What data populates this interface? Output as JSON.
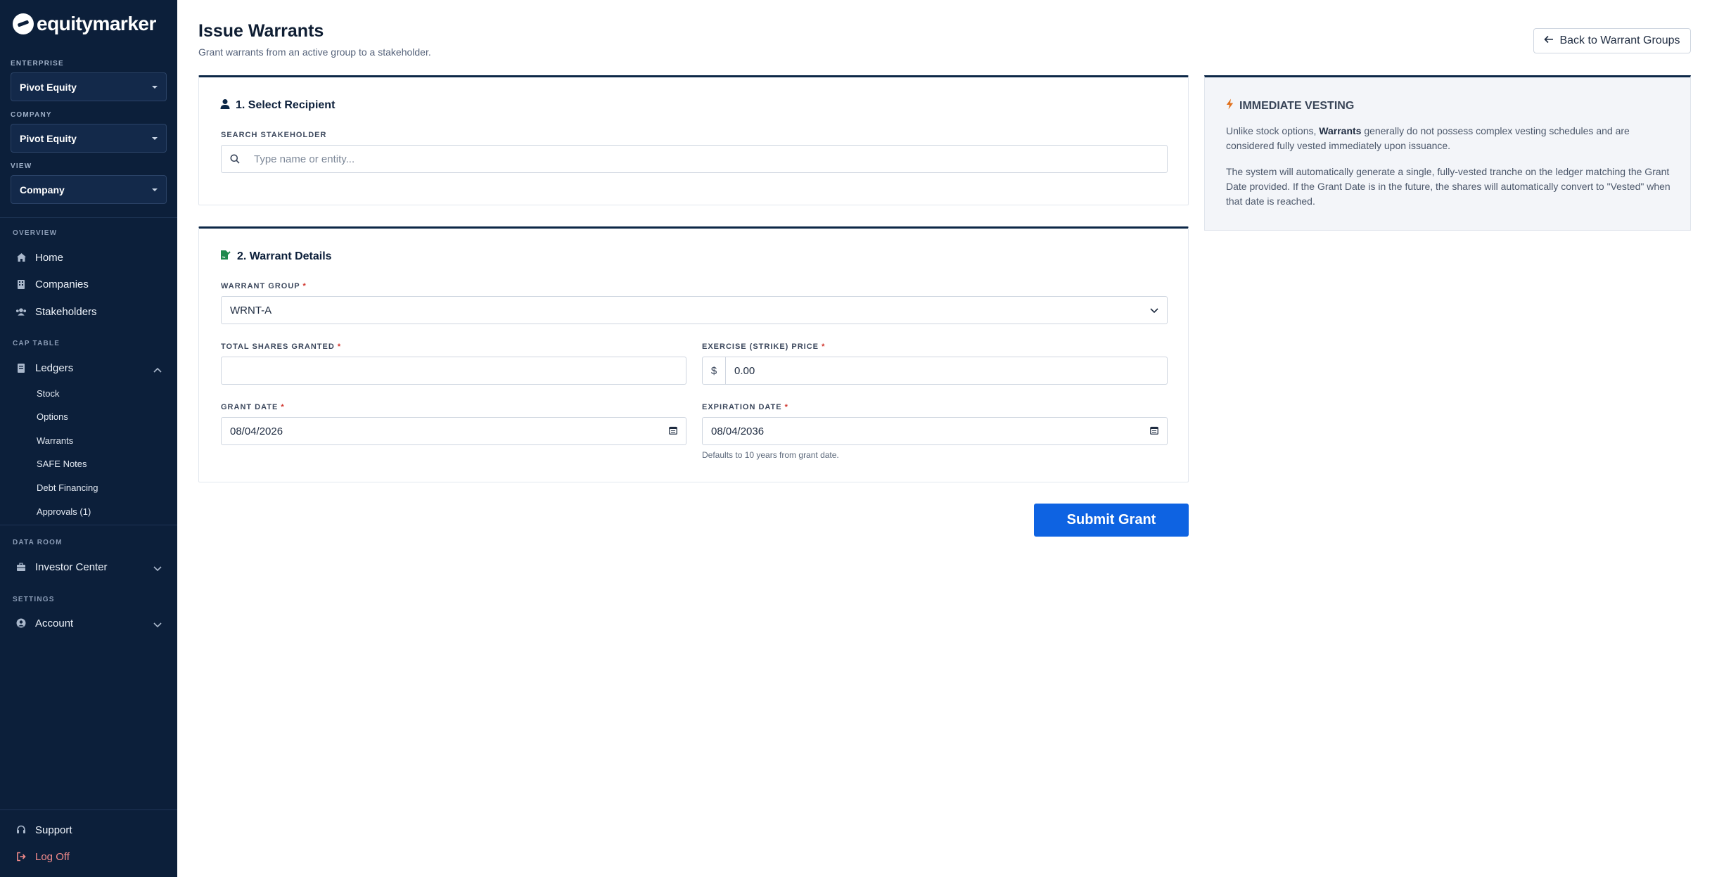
{
  "brand": {
    "name": "equitymarker"
  },
  "sidebar": {
    "enterprise_label": "ENTERPRISE",
    "enterprise_value": "Pivot Equity",
    "company_label": "COMPANY",
    "company_value": "Pivot Equity",
    "view_label": "VIEW",
    "view_value": "Company",
    "overview_label": "OVERVIEW",
    "home": "Home",
    "companies": "Companies",
    "stakeholders": "Stakeholders",
    "captable_label": "CAP TABLE",
    "ledgers": "Ledgers",
    "ledger_items": [
      "Stock",
      "Options",
      "Warrants",
      "SAFE Notes",
      "Debt Financing",
      "Approvals (1)"
    ],
    "dataroom_label": "DATA ROOM",
    "investor_center": "Investor Center",
    "settings_label": "SETTINGS",
    "account": "Account",
    "support": "Support",
    "logoff": "Log Off"
  },
  "header": {
    "title": "Issue Warrants",
    "subtitle": "Grant warrants from an active group to a stakeholder.",
    "back_label": "Back to Warrant Groups"
  },
  "recipient": {
    "title": "1. Select Recipient",
    "search_label": "SEARCH STAKEHOLDER",
    "search_placeholder": "Type name or entity..."
  },
  "details": {
    "title": "2. Warrant Details",
    "group_label": "WARRANT GROUP",
    "group_value": "WRNT-A",
    "shares_label": "TOTAL SHARES GRANTED",
    "shares_value": "",
    "price_label": "EXERCISE (STRIKE) PRICE",
    "price_prefix": "$",
    "price_value": "0.00",
    "grant_date_label": "GRANT DATE",
    "grant_date_value": "08/04/2026",
    "expiration_label": "EXPIRATION DATE",
    "expiration_value": "08/04/2036",
    "expiration_hint": "Defaults to 10 years from grant date.",
    "required_mark": "*"
  },
  "submit_label": "Submit Grant",
  "info": {
    "title": "IMMEDIATE VESTING",
    "p1_before": "Unlike stock options, ",
    "p1_bold": "Warrants",
    "p1_after": " generally do not possess complex vesting schedules and are considered fully vested immediately upon issuance.",
    "p2": "The system will automatically generate a single, fully-vested tranche on the ledger matching the Grant Date provided. If the Grant Date is in the future, the shares will automatically convert to \"Vested\" when that date is reached."
  },
  "colors": {
    "sidebar_bg": "#0c1f3a",
    "accent": "#0e63e2",
    "required": "#d0342c",
    "logoff": "#f38b8b"
  }
}
